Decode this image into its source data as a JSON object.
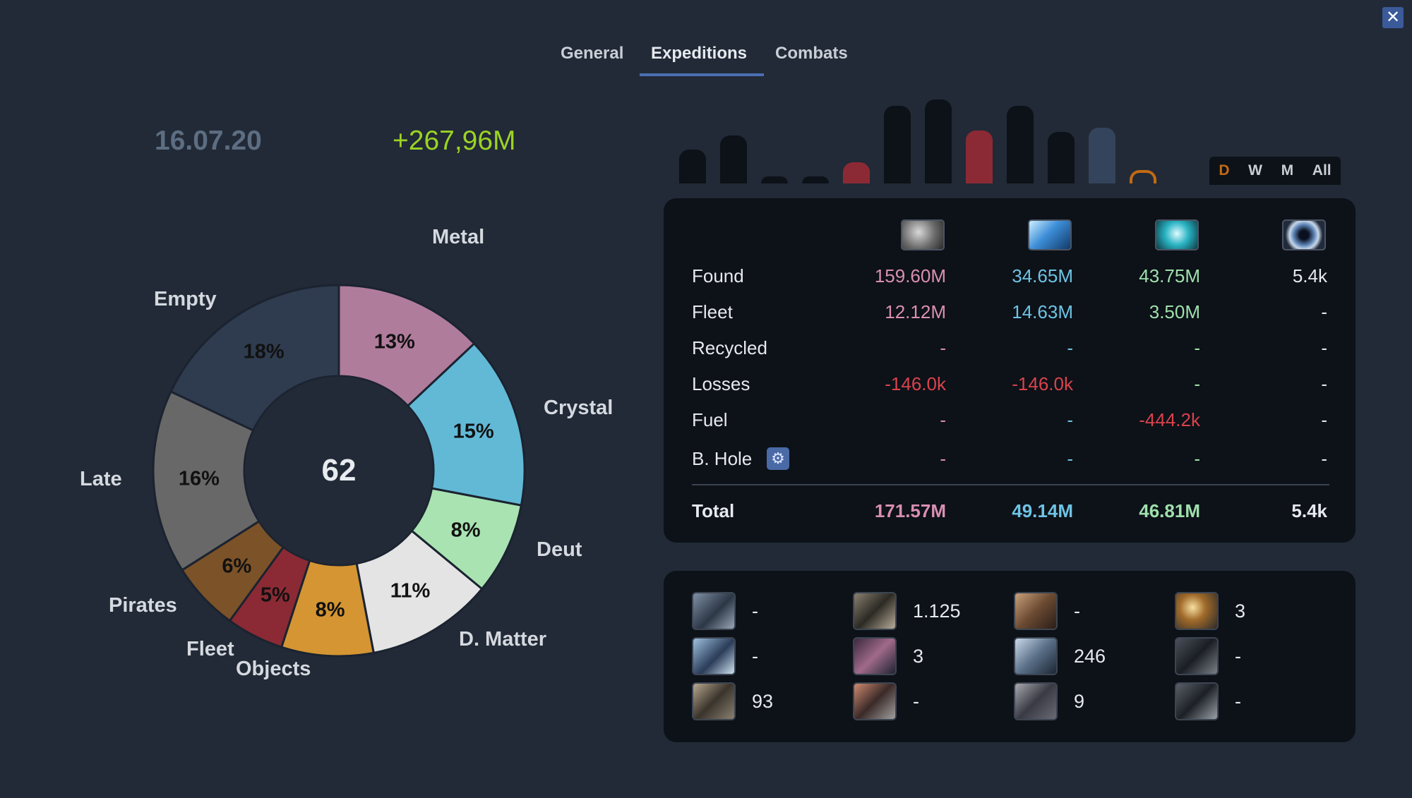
{
  "tabs": [
    "General",
    "Expeditions",
    "Combats"
  ],
  "active_tab": "Expeditions",
  "close_label": "✕",
  "summary": {
    "date": "16.07.20",
    "total": "+267,96M"
  },
  "donut": {
    "center_count": "62",
    "segments": [
      {
        "name": "Metal",
        "pct": 13,
        "label": "13%",
        "color": "#b07c9c"
      },
      {
        "name": "Crystal",
        "pct": 15,
        "label": "15%",
        "color": "#62b9d6"
      },
      {
        "name": "Deut",
        "pct": 8,
        "label": "8%",
        "color": "#a9e3b2"
      },
      {
        "name": "D. Matter",
        "pct": 11,
        "label": "11%",
        "color": "#e4e4e4"
      },
      {
        "name": "Objects",
        "pct": 8,
        "label": "8%",
        "color": "#d49532"
      },
      {
        "name": "Fleet",
        "pct": 5,
        "label": "5%",
        "color": "#8b2a34"
      },
      {
        "name": "Pirates",
        "pct": 6,
        "label": "6%",
        "color": "#7c5228"
      },
      {
        "name": "Late",
        "pct": 16,
        "label": "16%",
        "color": "#686868"
      },
      {
        "name": "Empty",
        "pct": 18,
        "label": "18%",
        "color": "#2f3b4e"
      }
    ]
  },
  "history_bars": [
    {
      "value": 0.44,
      "color": "#0d1118"
    },
    {
      "value": 0.62,
      "color": "#0d1118"
    },
    {
      "value": 0.09,
      "color": "#0d1118"
    },
    {
      "value": 0.09,
      "color": "#0d1118"
    },
    {
      "value": 0.27,
      "color": "#8b2a34"
    },
    {
      "value": 1.0,
      "color": "#0d1118"
    },
    {
      "value": 1.08,
      "color": "#0d1118"
    },
    {
      "value": 0.68,
      "color": "#8b2a34"
    },
    {
      "value": 1.0,
      "color": "#0d1118"
    },
    {
      "value": 0.66,
      "color": "#0d1118"
    },
    {
      "value": 0.72,
      "color": "#34445c"
    },
    {
      "value": 0.17,
      "color": "hollow"
    }
  ],
  "period_buttons": [
    "D",
    "W",
    "M",
    "All"
  ],
  "active_period": "D",
  "resources": {
    "icons": [
      "metal-icon",
      "crystal-icon",
      "deuterium-icon",
      "dark-matter-icon"
    ],
    "rows": [
      {
        "label": "Found",
        "values": [
          "159.60M",
          "34.65M",
          "43.75M",
          "5.4k"
        ]
      },
      {
        "label": "Fleet",
        "values": [
          "12.12M",
          "14.63M",
          "3.50M",
          "-"
        ]
      },
      {
        "label": "Recycled",
        "values": [
          "-",
          "-",
          "-",
          "-"
        ]
      },
      {
        "label": "Losses",
        "values": [
          "-146.0k",
          "-146.0k",
          "-",
          "-"
        ]
      },
      {
        "label": "Fuel",
        "values": [
          "-",
          "-",
          "-444.2k",
          "-"
        ]
      },
      {
        "label": "B. Hole",
        "values": [
          "-",
          "-",
          "-",
          "-"
        ]
      }
    ],
    "total": {
      "label": "Total",
      "values": [
        "171.57M",
        "49.14M",
        "46.81M",
        "5.4k"
      ]
    },
    "colors": {
      "metal": "#d98fb3",
      "crystal": "#6ec3e4",
      "deut": "#9fe0ac",
      "dm": "#e6e9ee",
      "negative": "#d9434c"
    }
  },
  "ships": [
    {
      "name": "ship-1-icon",
      "count": "-"
    },
    {
      "name": "ship-2-icon",
      "count": "1.125"
    },
    {
      "name": "ship-3-icon",
      "count": "-"
    },
    {
      "name": "ship-4-icon",
      "count": "3"
    },
    {
      "name": "ship-5-icon",
      "count": "-"
    },
    {
      "name": "ship-6-icon",
      "count": "3"
    },
    {
      "name": "ship-7-icon",
      "count": "246"
    },
    {
      "name": "ship-8-icon",
      "count": "-"
    },
    {
      "name": "ship-9-icon",
      "count": "93"
    },
    {
      "name": "ship-10-icon",
      "count": "-"
    },
    {
      "name": "ship-11-icon",
      "count": "9"
    },
    {
      "name": "ship-12-icon",
      "count": "-"
    }
  ]
}
